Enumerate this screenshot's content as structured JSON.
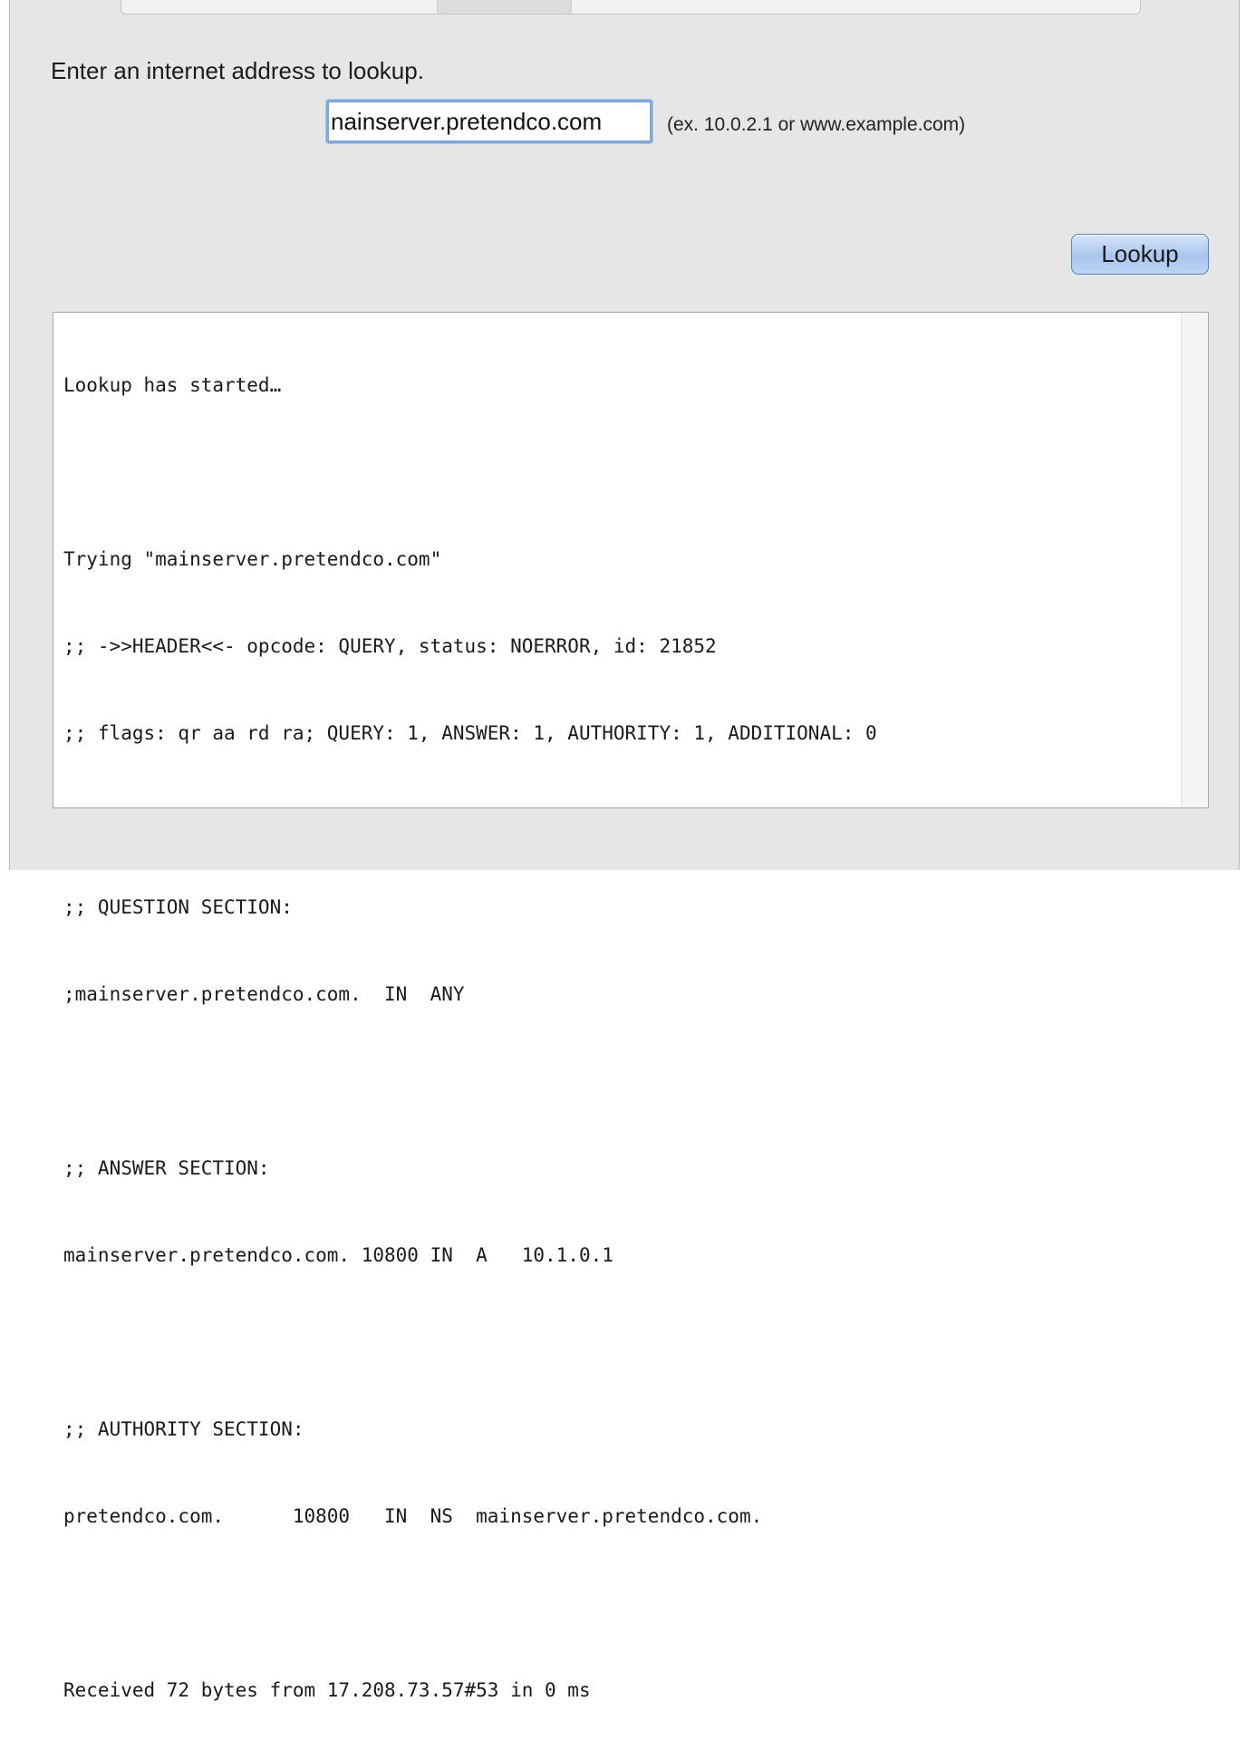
{
  "lookup_pane": {
    "prompt": "Enter an internet address to lookup.",
    "address_value": "nainserver.pretendco.com",
    "hint": "(ex. 10.0.2.1 or www.example.com)",
    "lookup_label": "Lookup"
  },
  "output": {
    "lines": [
      "Lookup has started…",
      "",
      "Trying \"mainserver.pretendco.com\"",
      ";; ->>HEADER<<- opcode: QUERY, status: NOERROR, id: 21852",
      ";; flags: qr aa rd ra; QUERY: 1, ANSWER: 1, AUTHORITY: 1, ADDITIONAL: 0",
      "",
      ";; QUESTION SECTION:",
      ";mainserver.pretendco.com.  IN  ANY",
      "",
      ";; ANSWER SECTION:",
      "mainserver.pretendco.com. 10800 IN  A   10.1.0.1",
      "",
      ";; AUTHORITY SECTION:",
      "pretendco.com.      10800   IN  NS  mainserver.pretendco.com.",
      "",
      "Received 72 bytes from 17.208.73.57#53 in 0 ms"
    ]
  }
}
